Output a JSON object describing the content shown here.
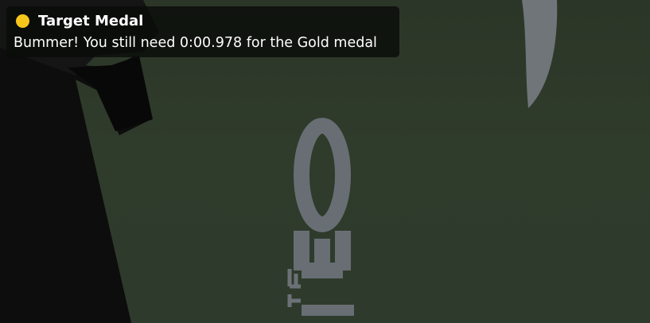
{
  "notification": {
    "title": "Target Medal",
    "message": "Bummer! You still need 0:00.978 for the Gold medal",
    "medal_icon": "gold-medal-icon",
    "medal_color": "#f6c71a"
  },
  "scene": {
    "ground_color": "#2f3a2a",
    "marking_color": "#6f747a",
    "shadow_color": "#101010"
  }
}
